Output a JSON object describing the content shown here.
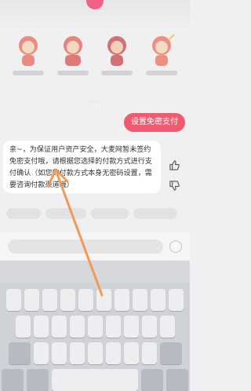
{
  "icons": {
    "thumbs_up": "thumbs-up-icon",
    "thumbs_down": "thumbs-down-icon"
  },
  "colors": {
    "accent": "#ef5c6f",
    "annotation_arrow": "#f29a55",
    "bubble_bg": "#ffffff"
  },
  "chat": {
    "quick_button_label": "设置免密支付",
    "reply_text": "亲~，为保证用户资产安全，大麦网暂未签约免密支付哦，请根据您选择的付款方式进行支付确认（如您的付款方式本身无密码设置，需要咨询付款渠道哦）"
  }
}
